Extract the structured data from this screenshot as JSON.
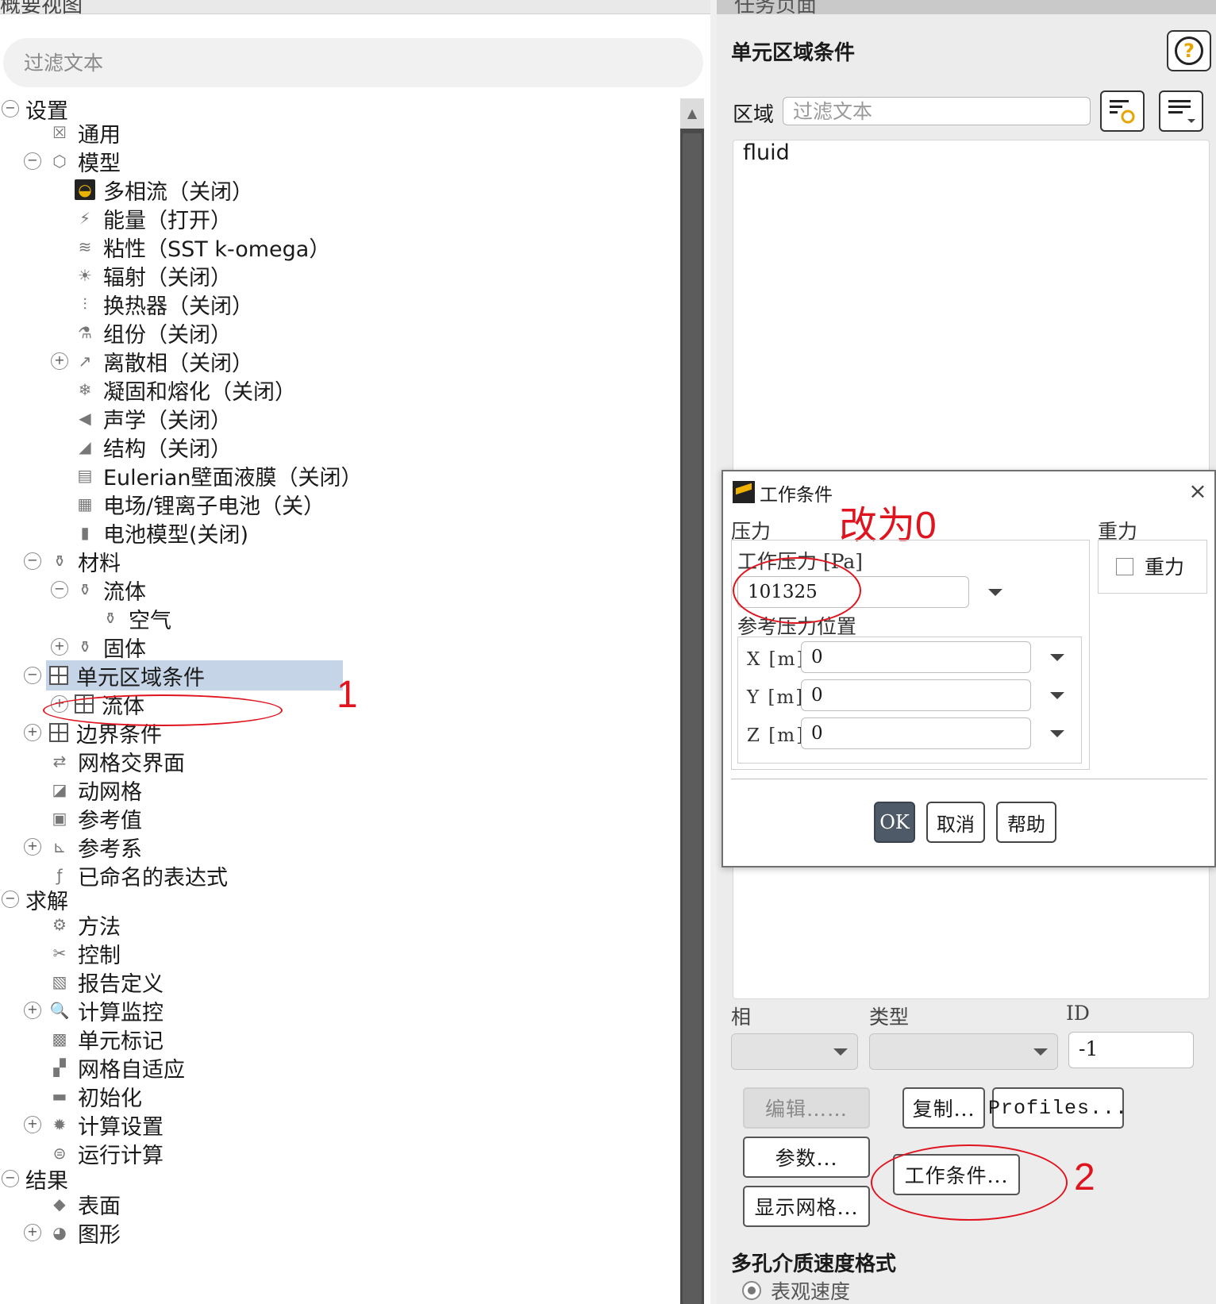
{
  "left_panel": {
    "title": "概要视图",
    "filter_placeholder": "过滤文本",
    "tree": [
      {
        "label": "设置",
        "toggle": "⊖",
        "icon": "",
        "icon_name": "none"
      },
      {
        "label": "通用",
        "toggle": "",
        "icon": "☒",
        "icon_name": "general-icon"
      },
      {
        "label": "模型",
        "toggle": "⊖",
        "icon": "⬡",
        "icon_name": "models-icon"
      },
      {
        "label": "多相流（关闭）",
        "toggle": "",
        "icon": "◒",
        "icon_name": "multiphase-icon"
      },
      {
        "label": "能量（打开）",
        "toggle": "",
        "icon": "⚡",
        "icon_name": "energy-icon"
      },
      {
        "label": "粘性（SST k-omega）",
        "toggle": "",
        "icon": "≋",
        "icon_name": "viscous-icon"
      },
      {
        "label": "辐射（关闭）",
        "toggle": "",
        "icon": "☀",
        "icon_name": "radiation-icon"
      },
      {
        "label": "换热器（关闭）",
        "toggle": "",
        "icon": "⫶",
        "icon_name": "heat-exchanger-icon"
      },
      {
        "label": "组份（关闭）",
        "toggle": "",
        "icon": "⚗",
        "icon_name": "species-icon"
      },
      {
        "label": "离散相（关闭）",
        "toggle": "⊕",
        "icon": "↗",
        "icon_name": "discrete-phase-icon"
      },
      {
        "label": "凝固和熔化（关闭）",
        "toggle": "",
        "icon": "❄",
        "icon_name": "solidification-icon"
      },
      {
        "label": "声学（关闭）",
        "toggle": "",
        "icon": "◀",
        "icon_name": "acoustics-icon"
      },
      {
        "label": "结构（关闭）",
        "toggle": "",
        "icon": "◢",
        "icon_name": "structure-icon"
      },
      {
        "label": "Eulerian壁面液膜（关闭）",
        "toggle": "",
        "icon": "▤",
        "icon_name": "wall-film-icon"
      },
      {
        "label": "电场/锂离子电池（关）",
        "toggle": "",
        "icon": "▦",
        "icon_name": "electric-field-icon"
      },
      {
        "label": "电池模型(关闭)",
        "toggle": "",
        "icon": "▮",
        "icon_name": "battery-icon"
      },
      {
        "label": "材料",
        "toggle": "⊖",
        "icon": "⚱",
        "icon_name": "materials-icon"
      },
      {
        "label": "流体",
        "toggle": "⊖",
        "icon": "⚱",
        "icon_name": "fluid-material-icon"
      },
      {
        "label": "空气",
        "toggle": "",
        "icon": "⚱",
        "icon_name": "air-icon"
      },
      {
        "label": "固体",
        "toggle": "⊕",
        "icon": "⚱",
        "icon_name": "solid-material-icon"
      },
      {
        "label": "单元区域条件",
        "toggle": "⊖",
        "icon": "grid",
        "icon_name": "cell-zone-icon"
      },
      {
        "label": "流体",
        "toggle": "⊕",
        "icon": "grid",
        "icon_name": "fluid-zone-icon"
      },
      {
        "label": "边界条件",
        "toggle": "⊕",
        "icon": "grid",
        "icon_name": "boundary-icon"
      },
      {
        "label": "网格交界面",
        "toggle": "",
        "icon": "⇄",
        "icon_name": "mesh-interface-icon"
      },
      {
        "label": "动网格",
        "toggle": "",
        "icon": "◪",
        "icon_name": "dynamic-mesh-icon"
      },
      {
        "label": "参考值",
        "toggle": "",
        "icon": "▣",
        "icon_name": "reference-values-icon"
      },
      {
        "label": "参考系",
        "toggle": "⊕",
        "icon": "⊾",
        "icon_name": "reference-frame-icon"
      },
      {
        "label": "已命名的表达式",
        "toggle": "",
        "icon": "ƒ",
        "icon_name": "expressions-icon"
      },
      {
        "label": "求解",
        "toggle": "⊖",
        "icon": "",
        "icon_name": "none"
      },
      {
        "label": "方法",
        "toggle": "",
        "icon": "⚙",
        "icon_name": "methods-icon"
      },
      {
        "label": "控制",
        "toggle": "",
        "icon": "✂",
        "icon_name": "controls-icon"
      },
      {
        "label": "报告定义",
        "toggle": "",
        "icon": "▧",
        "icon_name": "report-definitions-icon"
      },
      {
        "label": "计算监控",
        "toggle": "⊕",
        "icon": "🔍",
        "icon_name": "monitors-icon"
      },
      {
        "label": "单元标记",
        "toggle": "",
        "icon": "▩",
        "icon_name": "cell-registers-icon"
      },
      {
        "label": "网格自适应",
        "toggle": "",
        "icon": "▞",
        "icon_name": "mesh-adaption-icon"
      },
      {
        "label": "初始化",
        "toggle": "",
        "icon": "▬",
        "icon_name": "initialization-icon"
      },
      {
        "label": "计算设置",
        "toggle": "⊕",
        "icon": "✹",
        "icon_name": "calculation-activities-icon"
      },
      {
        "label": "运行计算",
        "toggle": "",
        "icon": "⊜",
        "icon_name": "run-calculation-icon"
      },
      {
        "label": "结果",
        "toggle": "⊖",
        "icon": "",
        "icon_name": "none"
      },
      {
        "label": "表面",
        "toggle": "",
        "icon": "◆",
        "icon_name": "surfaces-icon"
      },
      {
        "label": "图形",
        "toggle": "⊕",
        "icon": "◕",
        "icon_name": "graphics-icon"
      }
    ]
  },
  "right_panel": {
    "title": "任务页面",
    "heading": "单元区域条件",
    "zone_label": "区域",
    "zone_filter_placeholder": "过滤文本",
    "zones": [
      "fluid"
    ],
    "phase_label": "相",
    "type_label": "类型",
    "id_label": "ID",
    "id_value": "-1",
    "buttons": {
      "edit": "编辑……",
      "copy": "复制...",
      "profiles": "Profiles...",
      "parameters": "参数...",
      "operating_conditions": "工作条件...",
      "display_mesh": "显示网格..."
    },
    "porous_label": "多孔介质速度格式",
    "porous_option": "表观速度"
  },
  "dialog": {
    "title": "工作条件",
    "close": "×",
    "pressure_group": "压力",
    "operating_pressure_label": "工作压力 [Pa]",
    "operating_pressure_value": "101325",
    "ref_location_label": "参考压力位置",
    "x_label": "X [m]",
    "x_value": "0",
    "y_label": "Y [m]",
    "y_value": "0",
    "z_label": "Z [m]",
    "z_value": "0",
    "gravity_group": "重力",
    "gravity_checkbox": "重力",
    "ok": "OK",
    "cancel": "取消",
    "help": "帮助"
  },
  "annotations": {
    "note_1": "1",
    "note_2": "2",
    "note_change": "改为0",
    "color": "#e0141e"
  },
  "colors": {
    "selected_row": "#c5d4e6",
    "ok_button": "#4e5a67"
  }
}
